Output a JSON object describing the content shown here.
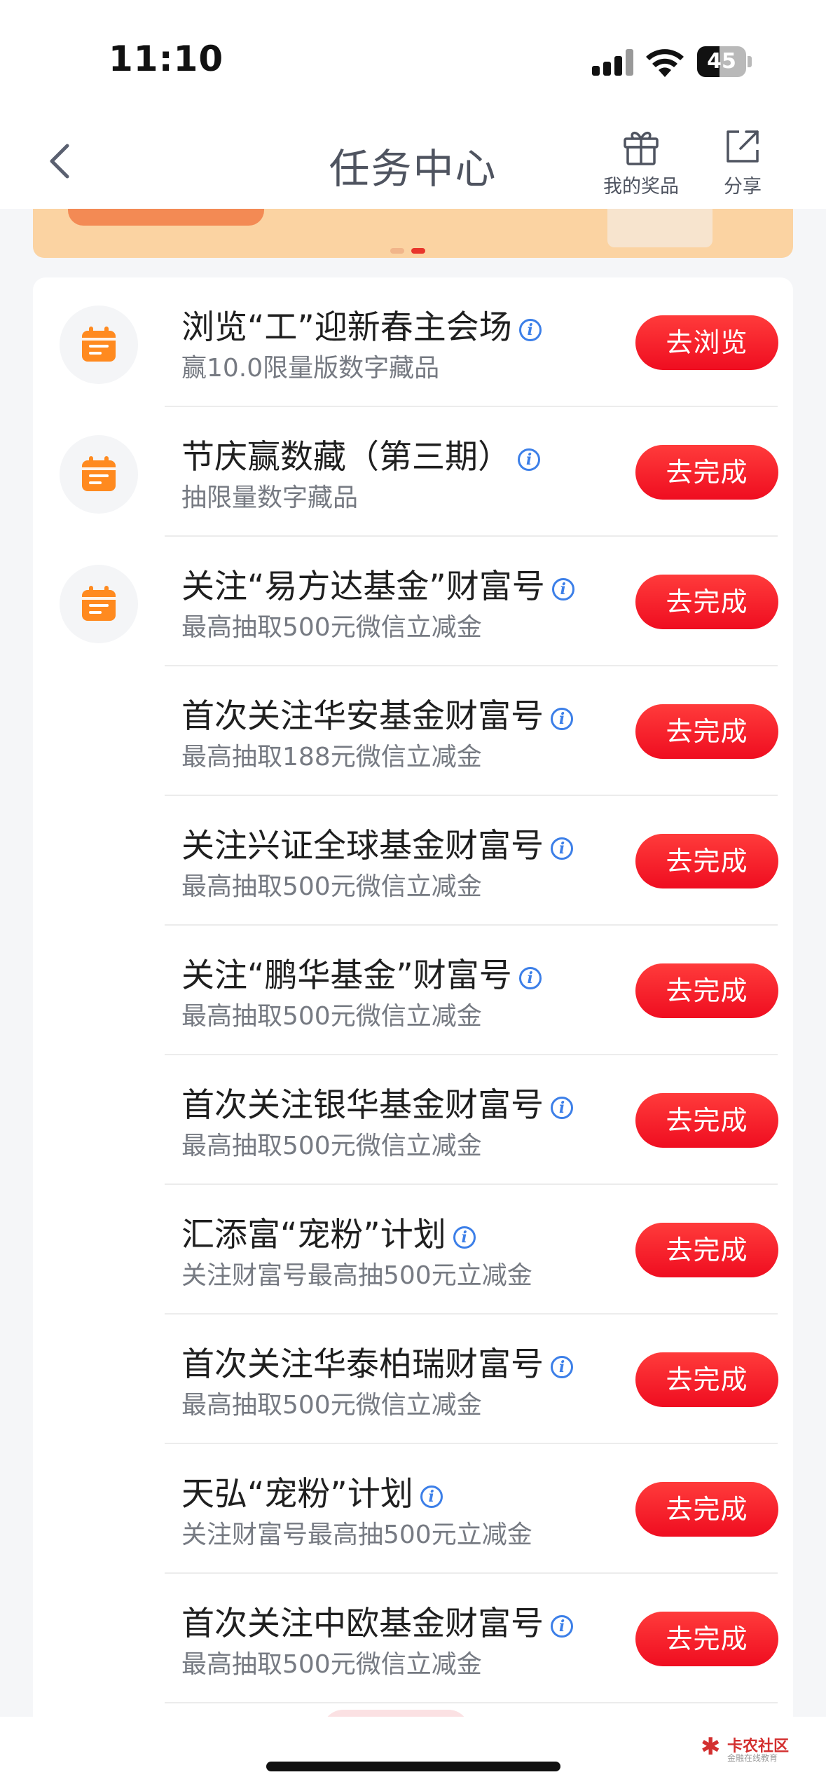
{
  "status_bar": {
    "time": "11:10",
    "battery": "45"
  },
  "nav": {
    "title": "任务中心",
    "my_prizes": "我的奖品",
    "share": "分享"
  },
  "colors": {
    "accent_red": "#f01322",
    "icon_orange": "#ff8a1f",
    "info_blue": "#3c7fe8"
  },
  "tasks": [
    {
      "title": "浏览“工”迎新春主会场",
      "subtitle": "赢10.0限量版数字藏品",
      "button": "去浏览",
      "icon": "calendar-icon"
    },
    {
      "title": "节庆赢数藏（第三期）",
      "subtitle": "抽限量数字藏品",
      "button": "去完成",
      "icon": "calendar-icon"
    },
    {
      "title": "关注“易方达基金”财富号",
      "subtitle": "最高抽取500元微信立减金",
      "button": "去完成",
      "icon": "calendar-icon"
    },
    {
      "title": "首次关注华安基金财富号",
      "subtitle": "最高抽取188元微信立减金",
      "button": "去完成"
    },
    {
      "title": "关注兴证全球基金财富号",
      "subtitle": "最高抽取500元微信立减金",
      "button": "去完成"
    },
    {
      "title": "关注“鹏华基金”财富号",
      "subtitle": "最高抽取500元微信立减金",
      "button": "去完成"
    },
    {
      "title": "首次关注银华基金财富号",
      "subtitle": "最高抽取500元微信立减金",
      "button": "去完成"
    },
    {
      "title": "汇添富“宠粉”计划",
      "subtitle": "关注财富号最高抽500元立减金",
      "button": "去完成"
    },
    {
      "title": "首次关注华泰柏瑞财富号",
      "subtitle": "最高抽取500元微信立减金",
      "button": "去完成"
    },
    {
      "title": "天弘“宠粉”计划",
      "subtitle": "关注财富号最高抽500元立减金",
      "button": "去完成"
    },
    {
      "title": "首次关注中欧基金财富号",
      "subtitle": "最高抽取500元微信立减金",
      "button": "去完成"
    }
  ],
  "watermark": {
    "name": "卡农社区",
    "tagline": "金融在线教育"
  }
}
